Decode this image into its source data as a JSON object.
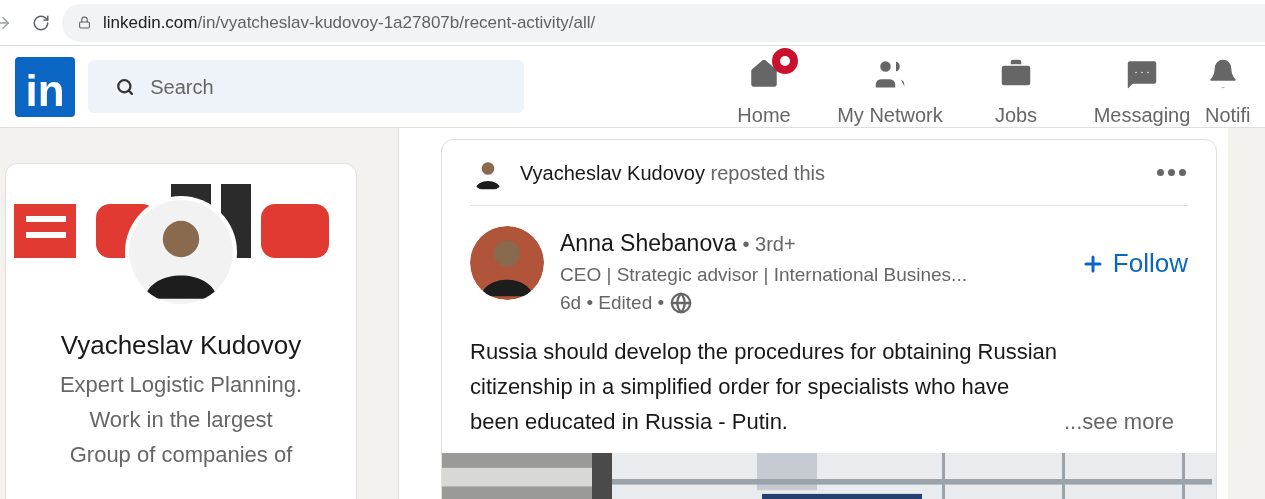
{
  "browser": {
    "url_host": "linkedin.com",
    "url_path": "/in/vyatcheslav-kudovoy-1a27807b/recent-activity/all/"
  },
  "nav": {
    "logo": "in",
    "search": {
      "placeholder": "Search"
    },
    "items": [
      {
        "kind": "home",
        "label": "Home",
        "badge": true
      },
      {
        "kind": "network",
        "label": "My Network",
        "badge": false
      },
      {
        "kind": "jobs",
        "label": "Jobs",
        "badge": false
      },
      {
        "kind": "messaging",
        "label": "Messaging",
        "badge": false
      },
      {
        "kind": "notifications",
        "label": "Notifi",
        "badge": false
      }
    ]
  },
  "profile_card": {
    "name": "Vyacheslav Kudovoy",
    "headline": [
      "Expert Logistic Planning.",
      "Work in the largest",
      "Group of companies of"
    ]
  },
  "post": {
    "repost": {
      "name": "Vyacheslav Kudovoy",
      "action": "reposted this"
    },
    "author": {
      "name": "Anna Shebanova",
      "degree": "• 3rd+",
      "headline": "CEO | Strategic advisor | International Busines...",
      "meta": "6d • Edited •"
    },
    "follow": "Follow",
    "text": "Russia should develop the procedures for obtaining Russian citizenship in a simplified order for specialists who have been educated in Russia - Putin.",
    "see_more": "...see more"
  }
}
